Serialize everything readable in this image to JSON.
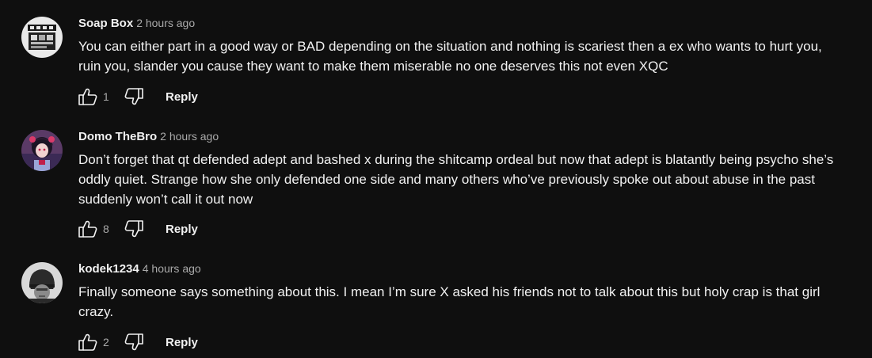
{
  "comments": [
    {
      "author": "Soap Box",
      "time": "2 hours ago",
      "lines": [
        "You can either part in a good way or BAD depending on the situation and nothing is scariest then a ex who wants to hurt you,",
        "ruin you, slander you cause they want to make them miserable no one deserves this not even XQC"
      ],
      "likes": "1",
      "reply_label": "Reply",
      "avatar_icon": "fake-it-logo-avatar"
    },
    {
      "author": "Domo TheBro",
      "time": "2 hours ago",
      "lines": [
        "Don’t forget that qt defended adept and bashed x during the shitcamp ordeal but now that adept is blatantly being psycho she’s",
        "oddly quiet. Strange how she only defended one side and many others who’ve previously spoke out about abuse in the past",
        "suddenly won’t call it out now"
      ],
      "likes": "8",
      "reply_label": "Reply",
      "avatar_icon": "anime-character-avatar"
    },
    {
      "author": "kodek1234",
      "time": "4 hours ago",
      "lines": [
        "Finally someone says something about this. I mean I’m sure X asked his friends not to talk about this but holy crap is that girl",
        "crazy."
      ],
      "likes": "2",
      "reply_label": "Reply",
      "avatar_icon": "helmet-portrait-avatar"
    }
  ],
  "colors": {
    "background": "#0f0f0f",
    "primary_text": "#f1f1f1",
    "secondary_text": "#aaaaaa"
  },
  "icons": {
    "like": "thumbs-up-icon",
    "dislike": "thumbs-down-icon"
  }
}
